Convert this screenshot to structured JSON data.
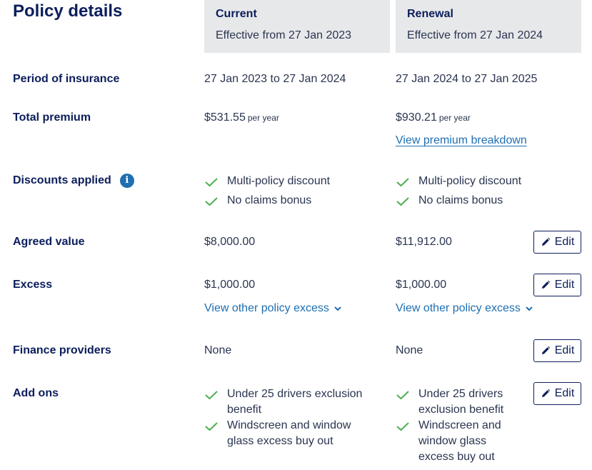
{
  "title": "Policy details",
  "columns": {
    "current": {
      "heading": "Current",
      "effective": "Effective from 27 Jan 2023"
    },
    "renewal": {
      "heading": "Renewal",
      "effective": "Effective from 27 Jan 2024"
    }
  },
  "rows": {
    "period": {
      "label": "Period of insurance",
      "current": "27 Jan 2023 to 27 Jan 2024",
      "renewal": "27 Jan 2024 to 27 Jan 2025"
    },
    "premium": {
      "label": "Total premium",
      "current": "$531.55",
      "renewal": "$930.21",
      "per": "per year",
      "breakdown_link": "View premium breakdown"
    },
    "discounts": {
      "label": "Discounts applied",
      "items": [
        "Multi-policy discount",
        "No claims bonus"
      ]
    },
    "agreed": {
      "label": "Agreed value",
      "current": "$8,000.00",
      "renewal": "$11,912.00"
    },
    "excess": {
      "label": "Excess",
      "current": "$1,000.00",
      "renewal": "$1,000.00",
      "other_link": "View other policy excess"
    },
    "finance": {
      "label": "Finance providers",
      "current": "None",
      "renewal": "None"
    },
    "addons": {
      "label": "Add ons",
      "current": [
        "Under 25 drivers exclusion benefit",
        "Windscreen and window glass excess buy out"
      ],
      "renewal": [
        "Under 25 drivers exclusion benefit",
        "Windscreen and window glass excess buy out"
      ]
    }
  },
  "edit_label": "Edit",
  "colors": {
    "navy": "#0c1e5b",
    "link": "#1f6fb2",
    "check": "#4caf50",
    "header_bg": "#e7e8ea"
  }
}
